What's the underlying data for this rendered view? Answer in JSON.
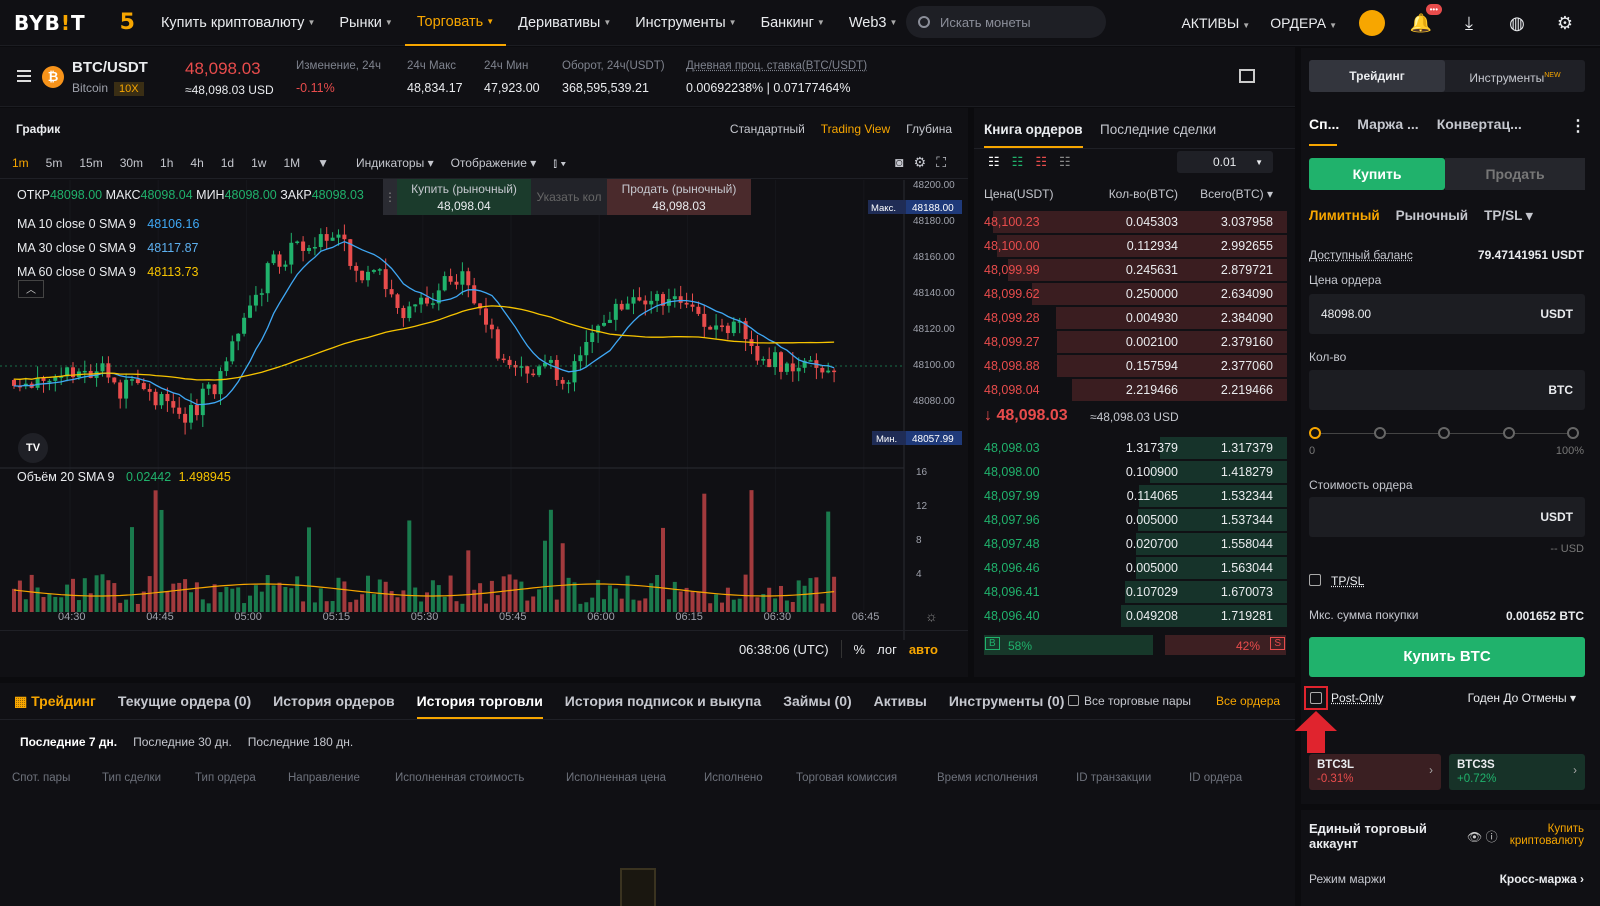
{
  "nav": {
    "logo_a": "BYB",
    "logo_b": "!",
    "logo_c": "T",
    "items": [
      "Купить криптовалюту",
      "Рынки",
      "Торговать",
      "Деривативы",
      "Инструменты",
      "Банкинг",
      "Web3"
    ],
    "search_placeholder": "Искать монеты",
    "right": [
      "АКТИВЫ",
      "ОРДЕРА"
    ],
    "badge": "•••"
  },
  "ticker": {
    "pair": "BTC/USDT",
    "name": "Bitcoin",
    "leverage": "10X",
    "price": "48,098.03",
    "price_usd": "≈48,098.03 USD",
    "stats": [
      {
        "l": "Изменение, 24ч",
        "v": "-0.11%"
      },
      {
        "l": "24ч Макс",
        "v": "48,834.17"
      },
      {
        "l": "24ч Мин",
        "v": "47,923.00"
      },
      {
        "l": "Оборот, 24ч(USDT)",
        "v": "368,595,539.21"
      },
      {
        "l": "Дневная проц. ставка(BTC/USDT)",
        "v": "0.00692238% | 0.07177464%"
      }
    ]
  },
  "chart": {
    "title": "График",
    "views": [
      "Стандартный",
      "Trading View",
      "Глубина"
    ],
    "intervals": [
      "1m",
      "5m",
      "15m",
      "30m",
      "1h",
      "4h",
      "1d",
      "1w",
      "1M"
    ],
    "indicators": "Индикаторы",
    "display": "Отображение",
    "ohlc": {
      "o_l": "ОТКР",
      "o": "48098.00",
      "h_l": "МАКС",
      "h": "48098.04",
      "l_l": "МИН",
      "l": "48098.00",
      "c_l": "ЗАКР",
      "c": "48098.03"
    },
    "ma": [
      {
        "l": "MA 10 close 0 SMA 9",
        "v": "48106.16",
        "c": "#3fa8f5"
      },
      {
        "l": "MA 30 close 0 SMA 9",
        "v": "48117.87",
        "c": "#5db0f0"
      },
      {
        "l": "MA 60 close 0 SMA 9",
        "v": "48113.73",
        "c": "#f7c400"
      }
    ],
    "buy_market": "Купить (рыночный)",
    "buy_price": "48,098.04",
    "qty_placeholder": "Указать кол",
    "sell_market": "Продать (рыночный)",
    "sell_price": "48,098.03",
    "y_ticks": [
      "48200.00",
      "48180.00",
      "48160.00",
      "48140.00",
      "48120.00",
      "48100.00",
      "48080.00"
    ],
    "max_tag": "Макс.",
    "max_val": "48188.00",
    "min_tag": "Мин.",
    "min_val": "48057.99",
    "vol_label": "Объём 20 SMA 9",
    "vol_a": "0.02442",
    "vol_b": "1.498945",
    "vol_ticks": [
      "16",
      "12",
      "8",
      "4"
    ],
    "x_ticks": [
      "04:30",
      "04:45",
      "05:00",
      "05:15",
      "05:30",
      "05:45",
      "06:00",
      "06:15",
      "06:30",
      "06:45"
    ],
    "time": "06:38:06 (UTC)",
    "pct": "%",
    "log": "лог",
    "auto": "авто"
  },
  "book": {
    "tabs": [
      "Книга ордеров",
      "Последние сделки"
    ],
    "step": "0.01",
    "cols": [
      "Цена(USDT)",
      "Кол-во(BTC)",
      "Всего(BTC)"
    ],
    "asks": [
      [
        "48,100.23",
        "0.045303",
        "3.037958"
      ],
      [
        "48,100.00",
        "0.112934",
        "2.992655"
      ],
      [
        "48,099.99",
        "0.245631",
        "2.879721"
      ],
      [
        "48,099.62",
        "0.250000",
        "2.634090"
      ],
      [
        "48,099.28",
        "0.004930",
        "2.384090"
      ],
      [
        "48,099.27",
        "0.002100",
        "2.379160"
      ],
      [
        "48,098.88",
        "0.157594",
        "2.377060"
      ],
      [
        "48,098.04",
        "2.219466",
        "2.219466"
      ]
    ],
    "last": "48,098.03",
    "last_usd": "≈48,098.03 USD",
    "bids": [
      [
        "48,098.03",
        "1.317379",
        "1.317379"
      ],
      [
        "48,098.00",
        "0.100900",
        "1.418279"
      ],
      [
        "48,097.99",
        "0.114065",
        "1.532344"
      ],
      [
        "48,097.96",
        "0.005000",
        "1.537344"
      ],
      [
        "48,097.48",
        "0.020700",
        "1.558044"
      ],
      [
        "48,096.46",
        "0.005000",
        "1.563044"
      ],
      [
        "48,096.41",
        "0.107029",
        "1.670073"
      ],
      [
        "48,096.40",
        "0.049208",
        "1.719281"
      ]
    ],
    "buy_pct": "58%",
    "sell_pct": "42%",
    "b": "B",
    "s": "S"
  },
  "order": {
    "top_tabs": [
      "Трейдинг",
      "Инструменты"
    ],
    "new": "NEW",
    "modes": [
      "Сп...",
      "Маржа ...",
      "Конвертац..."
    ],
    "buy": "Купить",
    "sell": "Продать",
    "types": [
      "Лимитный",
      "Рыночный",
      "TP/SL"
    ],
    "balance_l": "Доступный баланс",
    "balance": "79.47141951 USDT",
    "price_l": "Цена ордера",
    "price": "48098.00",
    "usdt": "USDT",
    "qty_l": "Кол-во",
    "btc": "BTC",
    "s0": "0",
    "s100": "100%",
    "value_l": "Стоимость ордера",
    "usd": "-- USD",
    "tpsl": "TP/SL",
    "max_l": "Мкс. сумма покупки",
    "max": "0.001652 BTC",
    "buy_btc": "Купить BTC",
    "post_only": "Post-Only",
    "tif": "Годен До Отмены",
    "lev": [
      {
        "n": "BTC3L",
        "v": "-0.31%"
      },
      {
        "n": "BTC3S",
        "v": "+0.72%"
      }
    ],
    "uta": "Единый торговый аккаунт",
    "buy_crypto": "Купить криптовалюту",
    "margin_mode_l": "Режим маржи",
    "margin_mode": "Кросс-маржа"
  },
  "bottom": {
    "tabs": [
      "Трейдинг",
      "Текущие ордера (0)",
      "История ордеров",
      "История торговли",
      "История подписок и выкупа",
      "Займы (0)",
      "Активы",
      "Инструменты (0)"
    ],
    "all_pairs": "Все торговые пары",
    "all_orders": "Все ордера",
    "periods": [
      "Последние 7 дн.",
      "Последние 30 дн.",
      "Последние 180 дн."
    ],
    "cols": [
      "Спот. пары",
      "Тип сделки",
      "Тип ордера",
      "Направление",
      "Исполненная стоимость",
      "Исполненная цена",
      "Исполнено",
      "Торговая комиссия",
      "Время исполнения",
      "ID транзакции",
      "ID ордера"
    ]
  }
}
